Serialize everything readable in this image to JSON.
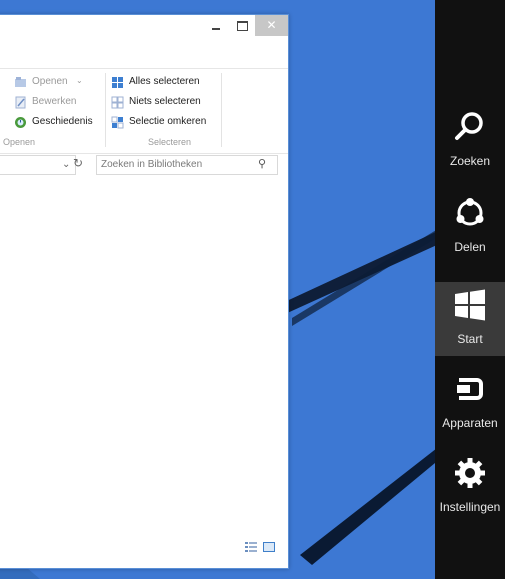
{
  "window": {
    "ribbon": {
      "open_group": {
        "items": [
          {
            "label": "Openen",
            "icon": "open-icon",
            "disabled": true
          },
          {
            "label": "Bewerken",
            "icon": "edit-icon",
            "disabled": true
          },
          {
            "label": "Geschiedenis",
            "icon": "history-icon",
            "disabled": false
          }
        ],
        "label": "Openen"
      },
      "select_group": {
        "items": [
          {
            "label": "Alles selecteren",
            "icon": "select-all-icon"
          },
          {
            "label": "Niets selecteren",
            "icon": "select-none-icon"
          },
          {
            "label": "Selectie omkeren",
            "icon": "invert-selection-icon"
          }
        ],
        "label": "Selecteren"
      }
    },
    "search_placeholder": "Zoeken in Bibliotheken"
  },
  "charms": [
    {
      "label": "Zoeken",
      "icon": "search-icon"
    },
    {
      "label": "Delen",
      "icon": "share-icon"
    },
    {
      "label": "Start",
      "icon": "windows-logo-icon",
      "active": true
    },
    {
      "label": "Apparaten",
      "icon": "devices-icon"
    },
    {
      "label": "Instellingen",
      "icon": "settings-gear-icon"
    }
  ],
  "colors": {
    "desktop": "#3d78d3",
    "charms_bg": "#111111",
    "charm_active": "#3a3a3a",
    "accent": "#1a7fd6"
  }
}
